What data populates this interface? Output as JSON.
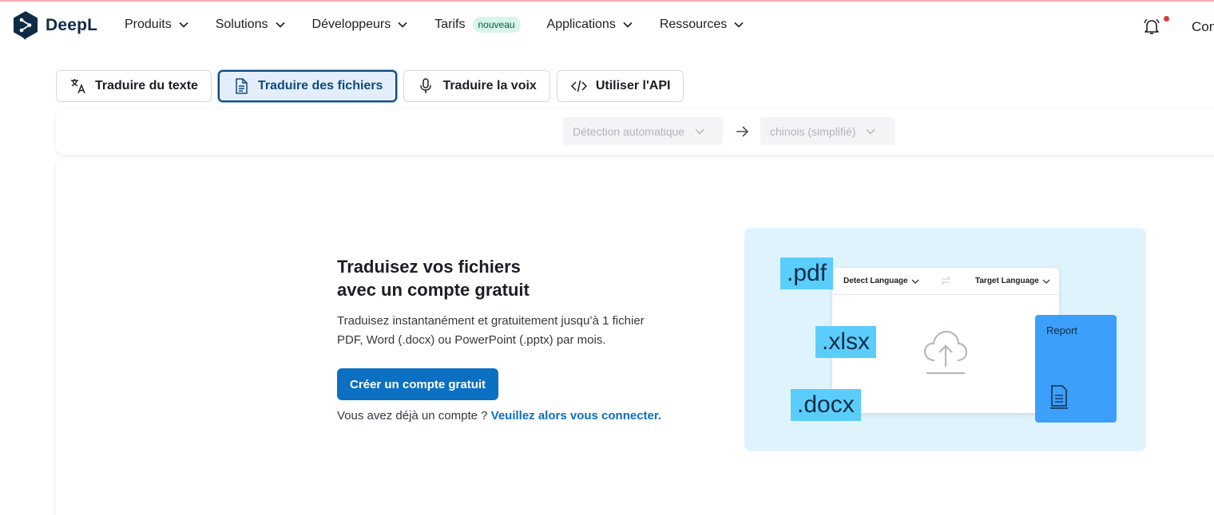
{
  "brand": {
    "name": "DeepL"
  },
  "nav": {
    "items": [
      {
        "label": "Produits"
      },
      {
        "label": "Solutions"
      },
      {
        "label": "Développeurs"
      },
      {
        "label": "Tarifs",
        "badge": "nouveau"
      },
      {
        "label": "Applications"
      },
      {
        "label": "Ressources"
      }
    ],
    "cut_label": "Con"
  },
  "tabs": [
    {
      "label": "Traduire du texte",
      "icon": "translate-icon"
    },
    {
      "label": "Traduire des fichiers",
      "icon": "document-icon",
      "active": true
    },
    {
      "label": "Traduire la voix",
      "icon": "microphone-icon"
    },
    {
      "label": "Utiliser l'API",
      "icon": "code-icon"
    }
  ],
  "language_bar": {
    "source": "Détection automatique",
    "target": "chinois (simplifié)"
  },
  "promo": {
    "title_line1": "Traduisez vos fichiers",
    "title_line2": "avec un compte gratuit",
    "desc_line1": "Traduisez instantanément et gratuitement jusqu’à 1 fichier",
    "desc_line2": "PDF, Word (.docx) ou PowerPoint (.pptx) par mois.",
    "cta_label": "Créer un compte gratuit",
    "login_text": "Vous avez déjà un compte ? ",
    "login_link": "Veuillez alors vous connecter."
  },
  "illustration": {
    "detect_language": "Detect Language",
    "target_language": "Target Language",
    "ext_pdf": ".pdf",
    "ext_xlsx": ".xlsx",
    "ext_docx": ".docx",
    "report": "Report"
  },
  "colors": {
    "brand_navy": "#0f2b46",
    "primary_blue": "#0b6fc2",
    "active_tab_bg": "#e3eefa",
    "badge_bg": "#d7f5e9",
    "illustration_bg": "#dff3fd",
    "file_tag": "#5bcdfb",
    "report_card": "#3c9ffa"
  }
}
